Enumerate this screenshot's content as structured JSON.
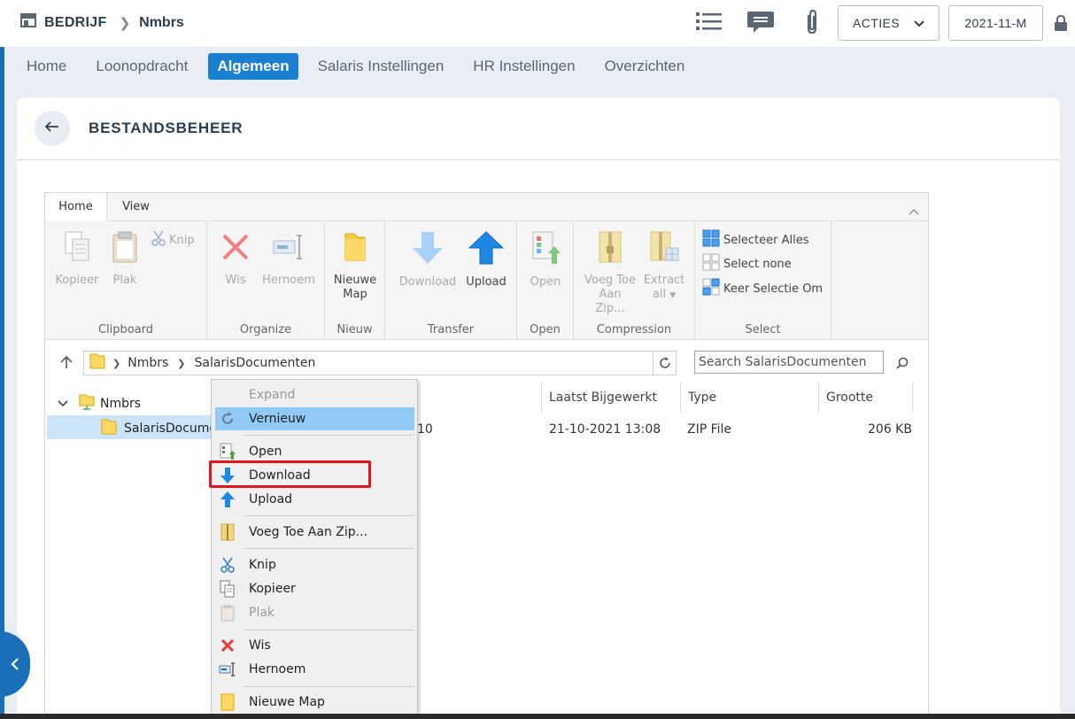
{
  "header": {
    "company_label": "BEDRIJF",
    "app_name": "Nmbrs",
    "actions_label": "ACTIES",
    "period_label": "2021-11-M"
  },
  "nav": {
    "tabs": [
      "Home",
      "Loonopdracht",
      "Algemeen",
      "Salaris Instellingen",
      "HR Instellingen",
      "Overzichten"
    ],
    "active": "Algemeen"
  },
  "page": {
    "title": "BESTANDSBEHEER"
  },
  "ribbon": {
    "tabs": [
      "Home",
      "View"
    ],
    "groups": {
      "clipboard": {
        "label": "Clipboard",
        "copy": "Kopieer",
        "paste": "Plak",
        "cut": "Knip"
      },
      "organize": {
        "label": "Organize",
        "delete": "Wis",
        "rename": "Hernoem"
      },
      "new": {
        "label": "Nieuw",
        "new_folder_1": "Nieuwe",
        "new_folder_2": "Map"
      },
      "transfer": {
        "label": "Transfer",
        "download": "Download",
        "upload": "Upload"
      },
      "open": {
        "label": "Open",
        "open": "Open"
      },
      "compression": {
        "label": "Compression",
        "zip_1": "Voeg Toe",
        "zip_2": "Aan",
        "zip_3": "Zip...",
        "extract_1": "Extract",
        "extract_2": "all"
      },
      "select": {
        "label": "Select",
        "select_all": "Selecteer Alles",
        "select_none": "Select none",
        "invert": "Keer Selectie Om"
      }
    }
  },
  "address": {
    "path": [
      "Nmbrs",
      "SalarisDocumenten"
    ],
    "search_placeholder": "Search SalarisDocumenten"
  },
  "tree": {
    "root": "Nmbrs",
    "child": "SalarisDocume"
  },
  "grid": {
    "columns": [
      "Laatst Bijgewerkt",
      "Type",
      "Grootte"
    ],
    "rows": [
      {
        "name_fragment": "10",
        "modified": "21-10-2021 13:08",
        "type": "ZIP File",
        "size": "206 KB"
      }
    ]
  },
  "context_menu": {
    "items": [
      "Expand",
      "Vernieuw",
      "Open",
      "Download",
      "Upload",
      "Voeg Toe Aan Zip...",
      "Knip",
      "Kopieer",
      "Plak",
      "Wis",
      "Hernoem",
      "Nieuwe Map"
    ],
    "highlighted": "Vernieuw",
    "annotated": "Download"
  },
  "colors": {
    "brand_blue": "#1a7fd1",
    "highlight_red": "#e3141c",
    "hover_blue": "#91c9f7"
  }
}
